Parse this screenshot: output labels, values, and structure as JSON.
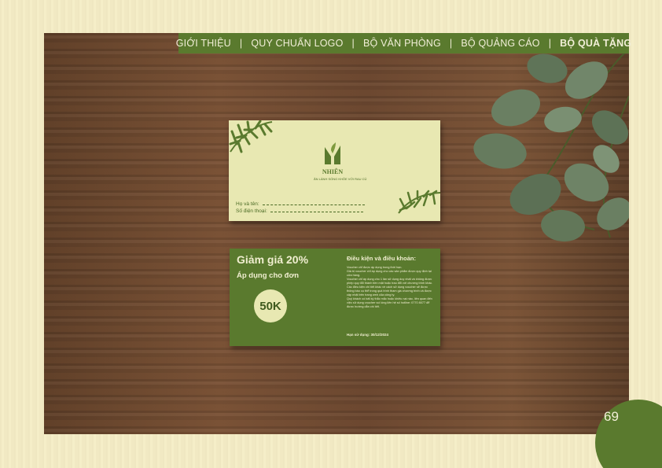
{
  "nav": {
    "items": [
      "GIỚI THIỆU",
      "QUY CHUẨN LOGO",
      "BỘ VĂN PHÒNG",
      "BỘ QUẢNG CÁO",
      "BỘ QUÀ TẶNG"
    ],
    "separator": "|",
    "active": "BỘ QUÀ TẶNG"
  },
  "card_front": {
    "brand": "NHIÊN",
    "tagline": "ĂN LÀNH SỐNG KHỎE VỚI RAU CỦ",
    "name_label": "Họ và tên:",
    "phone_label": "Số điện thoại:"
  },
  "card_back": {
    "title": "Giảm giá 20%",
    "subtitle": "Áp dụng cho đơn",
    "amount": "50K",
    "terms_title": "Điều kiện và điều khoản:",
    "terms": [
      "Voucher chỉ được áp dụng trong thời hạn.",
      "Giá trị voucher chỉ áp dụng cho các sản phẩm được quy định tại cửa hàng.",
      "Voucher chỉ áp dụng cho 1 lần sử dụng duy nhất và không được phép quy đổi thành tiền mặt hoặc trao đổi với chương trình khác.",
      "Các điều kiện chi tiết khác về cách sử dụng voucher sẽ được thông báo cụ thể trong quá trình tham gia chương trình và được cập nhật trên trang web của công ty.",
      "Quý khách có bất kỳ thắc mắc hoặc khiếu nại nào, liên quan đến việc sử dụng voucher vui lòng liên hệ số hotline: 0770 8077 để được hướng dẫn chi tiết."
    ],
    "expiry": "Hạn sử dụng: 30/12/2024"
  },
  "page_number": "69",
  "colors": {
    "brand_green": "#5a7a2e",
    "card_cream": "#e8e8b2",
    "page_background": "#f5edc6",
    "wood": "#6e4a30"
  }
}
